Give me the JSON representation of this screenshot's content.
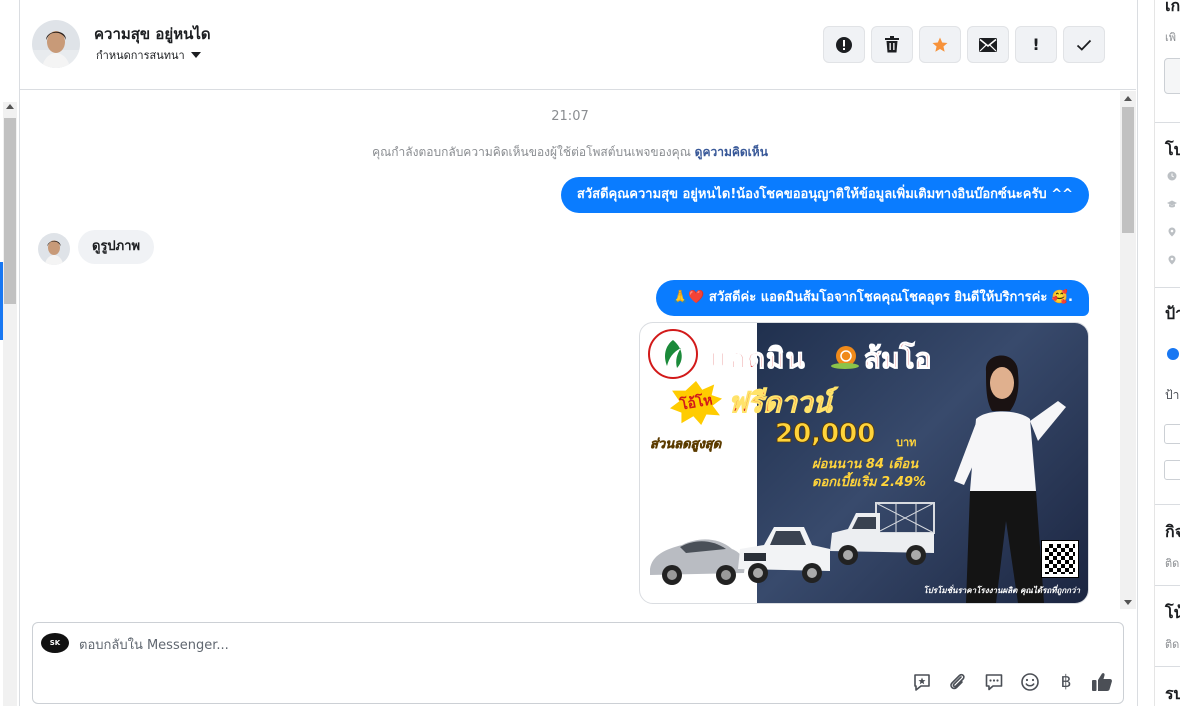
{
  "header": {
    "contact_name": "ความสุข อยู่หนได",
    "assign_label": "กำหนดการสนทนา"
  },
  "actions": [
    {
      "name": "report-spam",
      "icon": "alert-circle-icon"
    },
    {
      "name": "delete",
      "icon": "trash-icon"
    },
    {
      "name": "star",
      "icon": "star-icon",
      "color": "#f7923a"
    },
    {
      "name": "mark-unread",
      "icon": "envelope-icon"
    },
    {
      "name": "follow-up",
      "icon": "exclamation-icon",
      "label": "!"
    },
    {
      "name": "mark-done",
      "icon": "check-icon"
    }
  ],
  "thread": {
    "timestamp": "21:07",
    "notice_text": "คุณกำลังตอบกลับความคิดเห็นของผู้ใช้ต่อโพสต์บนเพจของคุณ",
    "notice_link": "ดูความคิดเห็น",
    "messages": [
      {
        "direction": "out",
        "text": "สวัสดีคุณความสุข อยู่หนได!น้องโชคขออนุญาติให้ข้อมูลเพิ่มเติมทางอินบ๊อกซ์นะครับ ^^"
      },
      {
        "direction": "in",
        "text": "ดูรูปภาพ"
      },
      {
        "direction": "out",
        "text": "🙏❤️ สวัสดีค่ะ แอดมินส้มโอจากโชคคุณโชคอุดร ยินดีให้บริการค่ะ 🥰."
      }
    ],
    "promo_image": {
      "headline": "แอดมิน",
      "headline_name": "ส้มโอ",
      "burst_text": "โอ้โห",
      "free_text": "ฟรีดาวน์",
      "discount_label": "ส่วนลดสูงสุด",
      "discount_amount": "20,000",
      "currency": "บาท",
      "installment": "ผ่อนนาน 84 เดือน",
      "rate": "ดอกเบี้ยเริ่ม 2.49%",
      "footer": "โปรโมชั่นราคาโรงงานผลิต คุณได้รถที่ถูกกว่า"
    }
  },
  "composer": {
    "placeholder": "ตอบกลับใน Messenger...",
    "tools": [
      {
        "name": "saved-reply",
        "icon": "saved-reply-icon"
      },
      {
        "name": "attach",
        "icon": "paperclip-icon"
      },
      {
        "name": "quick-reply",
        "icon": "chat-bubble-icon"
      },
      {
        "name": "emoji",
        "icon": "smiley-icon"
      },
      {
        "name": "payment",
        "icon": "baht-icon",
        "label": "฿"
      },
      {
        "name": "like",
        "icon": "thumbs-up-icon"
      }
    ]
  },
  "sidebar": {
    "sections": [
      {
        "title": "เก",
        "sub": "เพิ"
      },
      {
        "title": "โป"
      },
      {
        "title": "ป้า",
        "sub": "ป้า"
      },
      {
        "title": "กิจ",
        "sub": "ติด"
      },
      {
        "title": "โน้",
        "sub": "ติด"
      },
      {
        "title": "รบ"
      }
    ]
  },
  "colors": {
    "accent": "#0a7cff",
    "link": "#385898",
    "star": "#f7923a"
  }
}
